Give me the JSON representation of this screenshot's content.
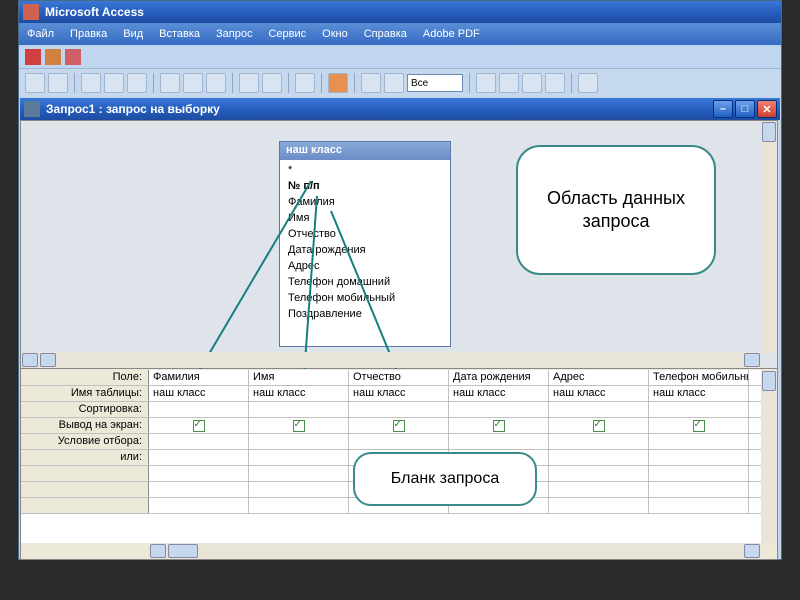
{
  "app": {
    "title": "Microsoft Access"
  },
  "menu": [
    "Файл",
    "Правка",
    "Вид",
    "Вставка",
    "Запрос",
    "Сервис",
    "Окно",
    "Справка",
    "Adobe PDF"
  ],
  "toolbar_combo": "Все",
  "query_window": {
    "title": "Запрос1 : запрос на выборку"
  },
  "field_list": {
    "title": "наш класс",
    "items": [
      "*",
      "№ п/п",
      "Фамилия",
      "Имя",
      "Отчество",
      "Дата рождения",
      "Адрес",
      "Телефон домашний",
      "Телефон мобильный",
      "Поздравление"
    ]
  },
  "callouts": {
    "data_area": "Область данных запроса",
    "grid_area": "Бланк запроса"
  },
  "grid": {
    "row_labels": [
      "Поле:",
      "Имя таблицы:",
      "Сортировка:",
      "Вывод на экран:",
      "Условие отбора:",
      "или:"
    ],
    "columns": [
      {
        "field": "Фамилия",
        "table": "наш класс",
        "sort": "",
        "show": true
      },
      {
        "field": "Имя",
        "table": "наш класс",
        "sort": "",
        "show": true
      },
      {
        "field": "Отчество",
        "table": "наш класс",
        "sort": "",
        "show": true
      },
      {
        "field": "Дата рождения",
        "table": "наш класс",
        "sort": "",
        "show": true
      },
      {
        "field": "Адрес",
        "table": "наш класс",
        "sort": "",
        "show": true
      },
      {
        "field": "Телефон мобильны",
        "table": "наш класс",
        "sort": "",
        "show": true
      }
    ]
  }
}
